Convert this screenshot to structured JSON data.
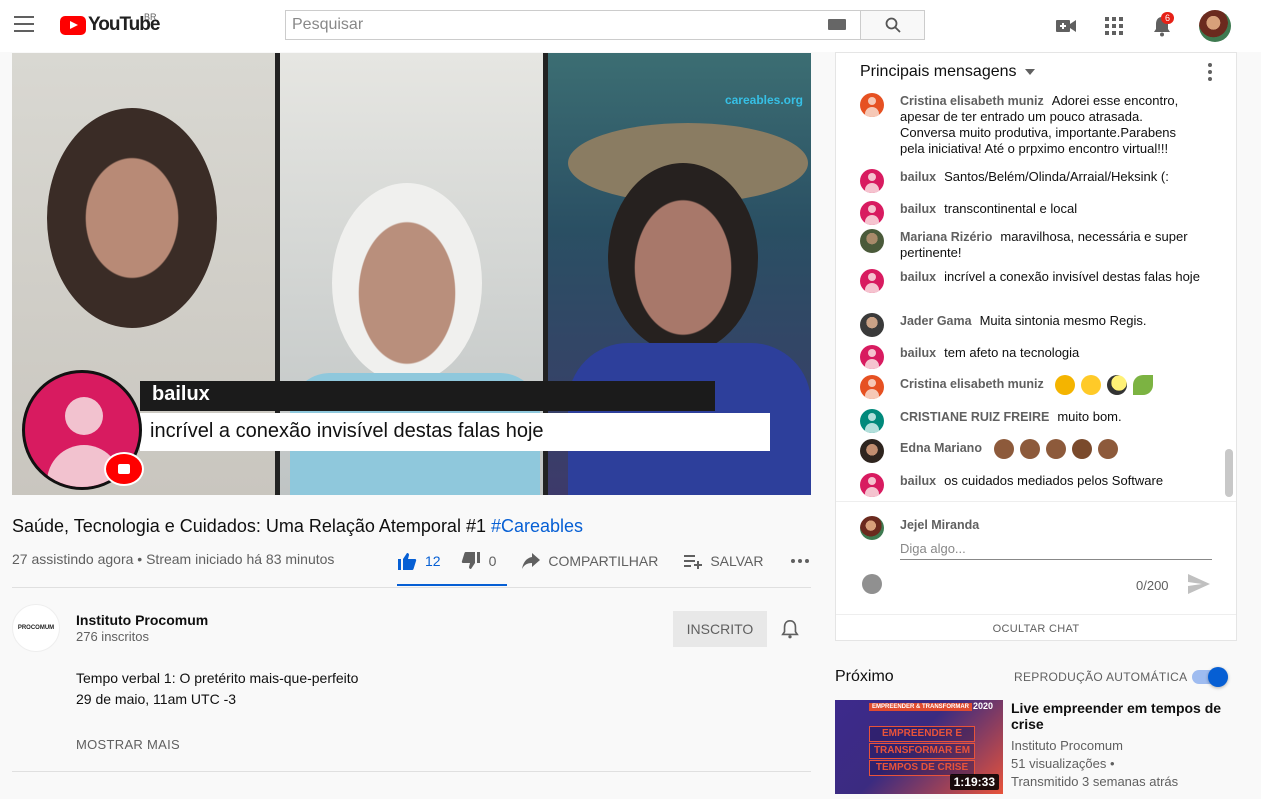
{
  "topbar": {
    "logo_text": "YouTube",
    "region": "BR",
    "search_placeholder": "Pesquisar",
    "notification_count": "6"
  },
  "player": {
    "watermark": "careables.org",
    "overlay_name": "bailux",
    "overlay_message": "incrível a conexão invisível destas falas hoje"
  },
  "video": {
    "title": "Saúde, Tecnologia e Cuidados: Uma Relação Atemporal #1",
    "hashtag": "#Careables",
    "meta": "27 assistindo agora • Stream iniciado há 83 minutos",
    "likes": "12",
    "dislikes": "0",
    "share_label": "COMPARTILHAR",
    "save_label": "SALVAR"
  },
  "channel": {
    "name": "Instituto Procomum",
    "subscribers": "276 inscritos",
    "avatar_text": "PROCOMUM",
    "subscribe_label": "INSCRITO",
    "description_line1": "Tempo verbal 1: O pretérito mais-que-perfeito",
    "description_line2": "29 de maio, 11am UTC -3",
    "show_more": "MOSTRAR MAIS"
  },
  "chat": {
    "header": "Principais mensagens",
    "messages": [
      {
        "author": "Cristina elisabeth muniz",
        "text": "Adorei esse encontro, apesar de ter entrado um pouco atrasada. Conversa muito produtiva, importante.Parabens pela iniciativa! Até o prpximo encontro virtual!!!"
      },
      {
        "author": "bailux",
        "text": "Santos/Belém/Olinda/Arraial/Heksink (:"
      },
      {
        "author": "bailux",
        "text": "transcontinental e local"
      },
      {
        "author": "Mariana Rizério",
        "text": "maravilhosa, necessária e super pertinente!"
      },
      {
        "author": "bailux",
        "text": "incrível a conexão invisível destas falas hoje"
      },
      {
        "author": "Jader Gama",
        "text": "Muita sintonia mesmo Regis."
      },
      {
        "author": "bailux",
        "text": "tem afeto na tecnologia"
      },
      {
        "author": "Cristina elisabeth muniz",
        "text": ""
      },
      {
        "author": "CRISTIANE RUIZ FREIRE",
        "text": "muito bom."
      },
      {
        "author": "Edna Mariano",
        "text": ""
      },
      {
        "author": "bailux",
        "text": "os cuidados mediados pelos Software"
      }
    ],
    "current_user": "Jejel Miranda",
    "input_placeholder": "Diga algo...",
    "counter": "0/200",
    "hide_label": "OCULTAR CHAT"
  },
  "up_next": {
    "label": "Próximo",
    "autoplay_label": "REPRODUÇÃO AUTOMÁTICA",
    "autoplay_on": true,
    "title": "Live empreender em tempos de crise",
    "channel": "Instituto Procomum",
    "views": "51 visualizações •",
    "streamed": "Transmitido 3 semanas atrás",
    "duration": "1:19:33",
    "thumb_banner": "EMPREENDER & TRANSFORMAR",
    "thumb_year": "2020",
    "thumb_line1": "EMPREENDER E",
    "thumb_line2": "TRANSFORMAR EM",
    "thumb_line3": "TEMPOS DE CRISE"
  }
}
